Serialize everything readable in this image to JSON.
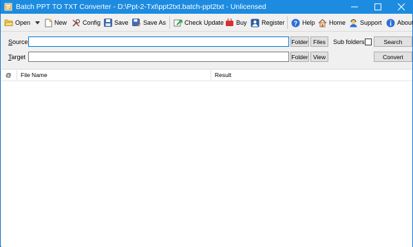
{
  "window": {
    "title": "Batch PPT TO TXT Converter - D:\\Ppt-2-Txt\\ppt2txt.batch-ppt2txt - Unlicensed"
  },
  "toolbar": {
    "open": "Open",
    "new": "New",
    "config": "Config",
    "save": "Save",
    "save_as": "Save As",
    "check_update": "Check Update",
    "buy": "Buy",
    "register": "Register",
    "help": "Help",
    "home": "Home",
    "support": "Support",
    "about": "About"
  },
  "source": {
    "label_underlined": "S",
    "label_rest": "ource",
    "value": "",
    "folder_button": "Folder",
    "files_button": "Files",
    "subfolders_label": "Sub folders",
    "subfolders_checked": false,
    "search_button": "Search"
  },
  "target": {
    "label_underlined": "T",
    "label_rest": "arget",
    "value": "",
    "folder_button": "Folder",
    "view_button": "View",
    "convert_button": "Convert"
  },
  "file_list": {
    "columns": {
      "status": "@",
      "file_name": "File Name",
      "result": "Result"
    },
    "rows": []
  },
  "colors": {
    "titlebar": "#1d8ce0",
    "window_border": "#1976d2"
  }
}
